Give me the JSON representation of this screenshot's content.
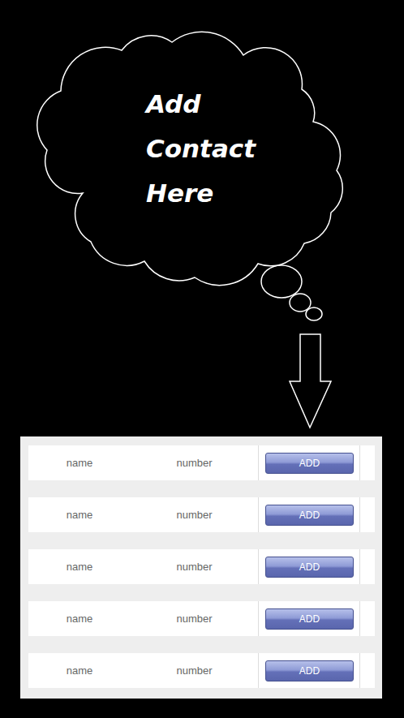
{
  "cloud": {
    "lines": [
      "Add",
      "Contact",
      "Here"
    ]
  },
  "contacts": [
    {
      "name": "name",
      "number": "number",
      "button": "ADD"
    },
    {
      "name": "name",
      "number": "number",
      "button": "ADD"
    },
    {
      "name": "name",
      "number": "number",
      "button": "ADD"
    },
    {
      "name": "name",
      "number": "number",
      "button": "ADD"
    },
    {
      "name": "name",
      "number": "number",
      "button": "ADD"
    }
  ]
}
